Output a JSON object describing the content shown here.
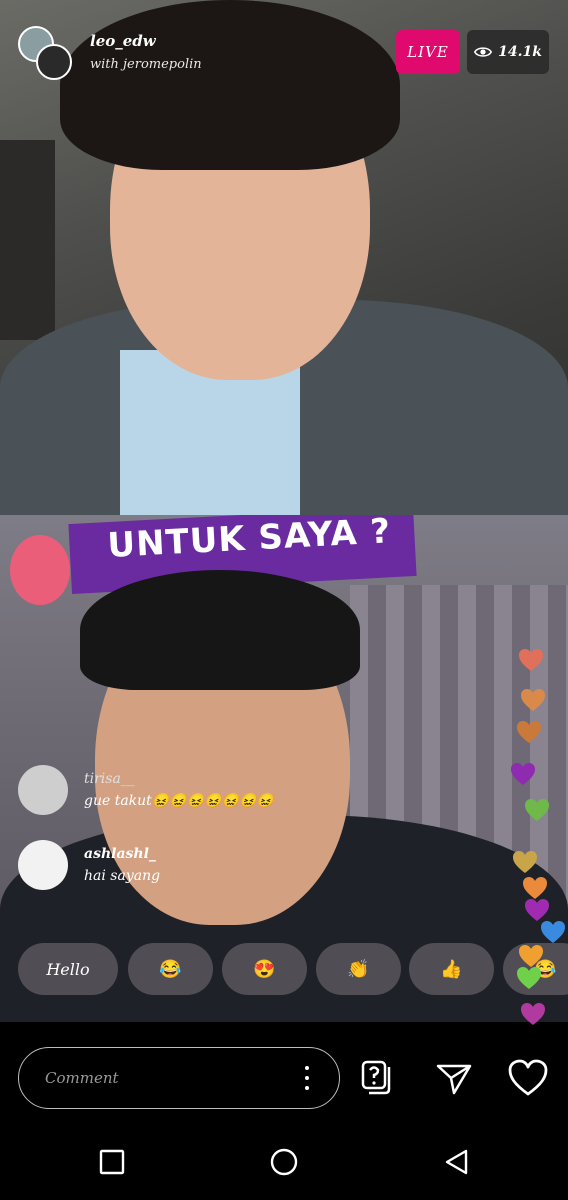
{
  "header": {
    "host_name": "leo_edw",
    "with_text": "with jeromepolin",
    "live_label": "LIVE",
    "viewer_count": "14.1k"
  },
  "overlay": {
    "banner_text": "UNTUK SAYA ?"
  },
  "comments": [
    {
      "user": "tirisa__",
      "message": "gue takut😖😖😖😖😖😖😖"
    },
    {
      "user": "ashlashl_",
      "message": "hai sayang"
    }
  ],
  "quick_replies": [
    "Hello",
    "😂",
    "😍",
    "👏",
    "👍",
    "😂"
  ],
  "composer": {
    "placeholder": "Comment"
  },
  "colors": {
    "live_pink": "#e0096e",
    "heart_colors": [
      "#e0705a",
      "#d98a4a",
      "#c97a3a",
      "#8e2bb0",
      "#6fb84a",
      "#c9a54a",
      "#ea8a3a",
      "#a02bb0",
      "#3a8ae0",
      "#f0a030",
      "#6fd04a",
      "#b03aa0"
    ]
  },
  "icons": {
    "viewer": "eye-icon",
    "question": "question-box-icon",
    "send": "send-icon",
    "like": "heart-outline-icon",
    "more": "more-vertical-icon",
    "nav_recents": "recents-square-icon",
    "nav_home": "home-circle-icon",
    "nav_back": "back-triangle-icon"
  }
}
